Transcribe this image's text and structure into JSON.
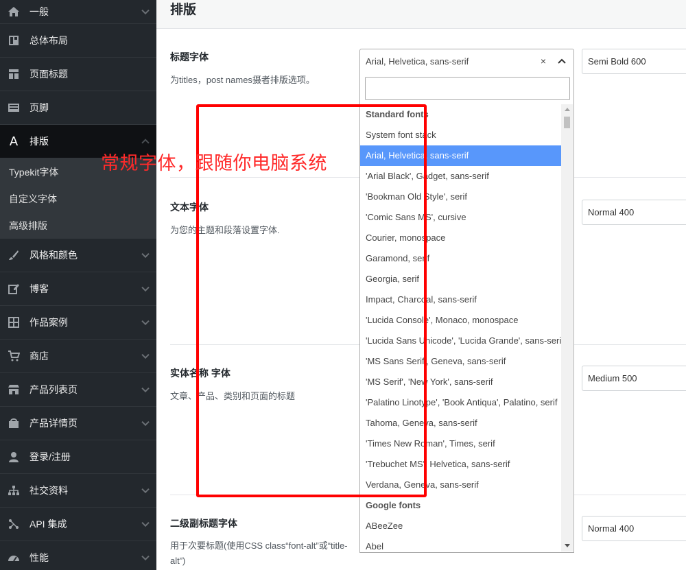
{
  "sidebar": {
    "items": [
      {
        "label": "一般",
        "icon": "home-icon"
      },
      {
        "label": "总体布局",
        "icon": "layout-icon"
      },
      {
        "label": "页面标题",
        "icon": "page-title-icon"
      },
      {
        "label": "页脚",
        "icon": "footer-icon"
      },
      {
        "label": "排版",
        "icon": "typography-icon",
        "icon_glyph": "A",
        "active": true
      },
      {
        "label": "风格和颜色",
        "icon": "brush-icon"
      },
      {
        "label": "博客",
        "icon": "edit-icon"
      },
      {
        "label": "作品案例",
        "icon": "grid-icon"
      },
      {
        "label": "商店",
        "icon": "cart-icon"
      },
      {
        "label": "产品列表页",
        "icon": "store-icon"
      },
      {
        "label": "产品详情页",
        "icon": "product-icon"
      },
      {
        "label": "登录/注册",
        "icon": "user-icon"
      },
      {
        "label": "社交资料",
        "icon": "network-icon"
      },
      {
        "label": "API 集成",
        "icon": "api-icon"
      },
      {
        "label": "性能",
        "icon": "gauge-icon"
      }
    ],
    "sub_items": [
      "Typekit字体",
      "自定义字体",
      "高级排版"
    ]
  },
  "page": {
    "title": "排版"
  },
  "fields": [
    {
      "label": "标题字体",
      "desc": "为titles，post names摄者排版选项。",
      "weight": "Semi Bold 600"
    },
    {
      "label": "文本字体",
      "desc": "为您的主题和段落设置字体.",
      "weight": "Normal 400"
    },
    {
      "label": "实体名称 字体",
      "desc": "文章、产品、类别和页面的标题",
      "weight": "Medium 500"
    },
    {
      "label": "二级副标题字体",
      "desc_line1": "用于次要标题(使用CSS class“font-alt”或“title-",
      "desc_line2": "alt”)",
      "weight": "Normal 400"
    }
  ],
  "font_select": {
    "value": "Arial, Helvetica, sans-serif",
    "clear": "×",
    "search_value": "",
    "groups": [
      {
        "name": "Standard fonts",
        "options": [
          "System font stack",
          "Arial, Helvetica, sans-serif",
          "'Arial Black', Gadget, sans-serif",
          "'Bookman Old Style', serif",
          "'Comic Sans MS', cursive",
          "Courier, monospace",
          "Garamond, serif",
          "Georgia, serif",
          "Impact, Charcoal, sans-serif",
          "'Lucida Console', Monaco, monospace",
          "'Lucida Sans Unicode', 'Lucida Grande', sans-serif",
          "'MS Sans Serif', Geneva, sans-serif",
          "'MS Serif', 'New York', sans-serif",
          "'Palatino Linotype', 'Book Antiqua', Palatino, serif",
          "Tahoma, Geneva, sans-serif",
          "'Times New Roman', Times, serif",
          "'Trebuchet MS', Helvetica, sans-serif",
          "Verdana, Geneva, sans-serif"
        ]
      },
      {
        "name": "Google fonts",
        "options": [
          "ABeeZee",
          "Abel"
        ]
      }
    ],
    "selected_index": 1
  },
  "annotation": {
    "text": "常规字体，跟随你电脑系统",
    "color": "#ff2a2a"
  },
  "colors": {
    "sidebar_bg": "#23282d",
    "selected_bg": "#5897fb",
    "highlight_box": "#ff0000"
  }
}
